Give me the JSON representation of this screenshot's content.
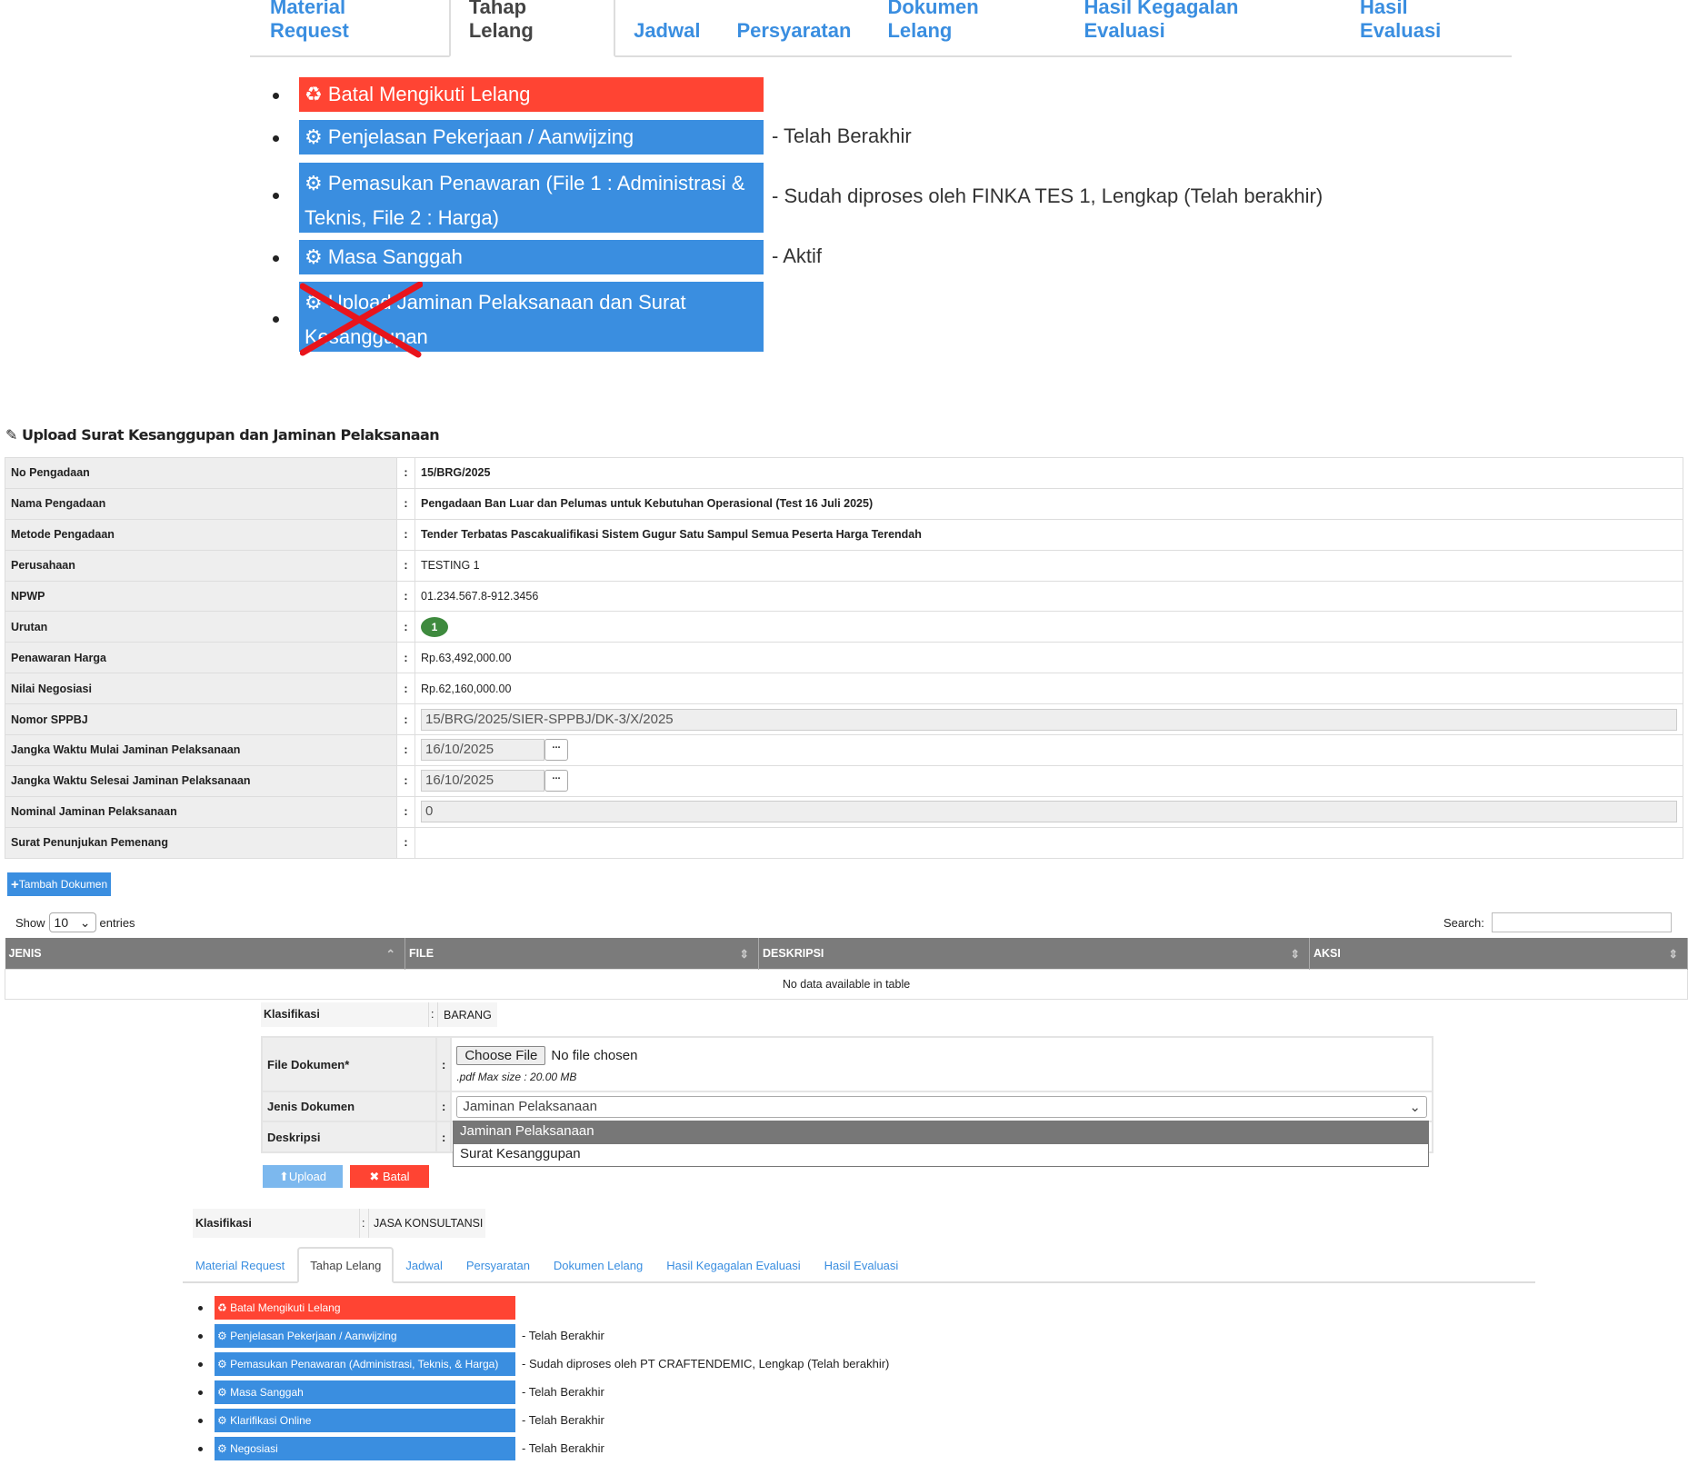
{
  "top_tabs": [
    "Material Request",
    "Tahap Lelang",
    "Jadwal",
    "Persyaratan",
    "Dokumen Lelang",
    "Hasil Kegagalan Evaluasi",
    "Hasil Evaluasi"
  ],
  "top_tabs_active": 1,
  "top_steps": [
    {
      "label": "Batal Mengikuti Lelang",
      "status": "",
      "color": "#ff4433",
      "icon": "recycle-icon"
    },
    {
      "label": "Penjelasan Pekerjaan / Aanwijzing",
      "status": "- Telah Berakhir",
      "color": "#3a8ee0",
      "icon": "gears-icon"
    },
    {
      "label": "Pemasukan Penawaran (File 1 : Administrasi & Teknis, File 2 : Harga)",
      "status": "- Sudah diproses oleh FINKA TES 1, Lengkap (Telah berakhir)",
      "color": "#3a8ee0",
      "icon": "gears-icon"
    },
    {
      "label": "Masa Sanggah",
      "status": "- Aktif",
      "color": "#3a8ee0",
      "icon": "gears-icon"
    },
    {
      "label": "Upload Jaminan Pelaksanaan dan Surat Kesanggupan",
      "status": "",
      "color": "#3a8ee0",
      "icon": "gears-icon",
      "crossed": true
    }
  ],
  "section_title": "Upload Surat Kesanggupan dan Jaminan Pelaksanaan",
  "info": {
    "no_pengadaan": {
      "label": "No Pengadaan",
      "value": "15/BRG/2025"
    },
    "nama": {
      "label": "Nama Pengadaan",
      "value": "Pengadaan Ban Luar dan Pelumas untuk Kebutuhan Operasional (Test 16 Juli 2025)"
    },
    "metode": {
      "label": "Metode Pengadaan",
      "value": "Tender Terbatas Pascakualifikasi Sistem Gugur Satu Sampul Semua Peserta Harga Terendah"
    },
    "perusahaan": {
      "label": "Perusahaan",
      "value": "TESTING 1"
    },
    "npwp": {
      "label": "NPWP",
      "value": "01.234.567.8-912.3456"
    },
    "urutan": {
      "label": "Urutan",
      "value": "1"
    },
    "penawaran": {
      "label": "Penawaran Harga",
      "value": "Rp.63,492,000.00"
    },
    "negosiasi": {
      "label": "Nilai Negosiasi",
      "value": "Rp.62,160,000.00"
    },
    "sppbj": {
      "label": "Nomor SPPBJ",
      "value": "15/BRG/2025/SIER-SPPBJ/DK-3/X/2025"
    },
    "mulai": {
      "label": "Jangka Waktu Mulai Jaminan Pelaksanaan",
      "value": "16/10/2025"
    },
    "selesai": {
      "label": "Jangka Waktu Selesai Jaminan Pelaksanaan",
      "value": "16/10/2025"
    },
    "nominal": {
      "label": "Nominal Jaminan Pelaksanaan",
      "value": "0"
    },
    "surat": {
      "label": "Surat Penunjukan Pemenang",
      "value": ""
    },
    "colon": ":",
    "picker": "..."
  },
  "tambah_label": "Tambah Dokumen",
  "show_label": "Show",
  "entries_label": "entries",
  "entries_value": "10",
  "search_label": "Search:",
  "table": {
    "headers": [
      "JENIS",
      "FILE",
      "DESKRIPSI",
      "AKSI"
    ],
    "empty": "No data available in table"
  },
  "klasifikasi1": {
    "label": "Klasifikasi",
    "value": "BARANG"
  },
  "form": {
    "file_label": "File Dokumen*",
    "choose": "Choose File",
    "no_file": "No file chosen",
    "hint": ".pdf Max size : 20.00 MB",
    "jenis_label": "Jenis Dokumen",
    "jenis_value": "Jaminan Pelaksanaan",
    "options": [
      "Jaminan Pelaksanaan",
      "Surat Kesanggupan"
    ],
    "deskripsi_label": "Deskripsi",
    "upload": "Upload",
    "batal": "Batal"
  },
  "klasifikasi2": {
    "label": "Klasifikasi",
    "value": "JASA KONSULTANSI"
  },
  "bottom_tabs": [
    "Material Request",
    "Tahap Lelang",
    "Jadwal",
    "Persyaratan",
    "Dokumen Lelang",
    "Hasil Kegagalan Evaluasi",
    "Hasil Evaluasi"
  ],
  "bottom_steps": [
    {
      "label": "Batal Mengikuti Lelang",
      "status": "",
      "color": "#ff4433"
    },
    {
      "label": "Penjelasan Pekerjaan / Aanwijzing",
      "status": "- Telah Berakhir",
      "color": "#3a8ee0"
    },
    {
      "label": "Pemasukan Penawaran (Administrasi, Teknis, & Harga)",
      "status": "- Sudah diproses oleh PT CRAFTENDEMIC, Lengkap (Telah berakhir)",
      "color": "#3a8ee0"
    },
    {
      "label": "Masa Sanggah",
      "status": "- Telah Berakhir",
      "color": "#3a8ee0"
    },
    {
      "label": "Klarifikasi Online",
      "status": "- Telah Berakhir",
      "color": "#3a8ee0"
    },
    {
      "label": "Negosiasi",
      "status": "- Telah Berakhir",
      "color": "#3a8ee0"
    }
  ]
}
